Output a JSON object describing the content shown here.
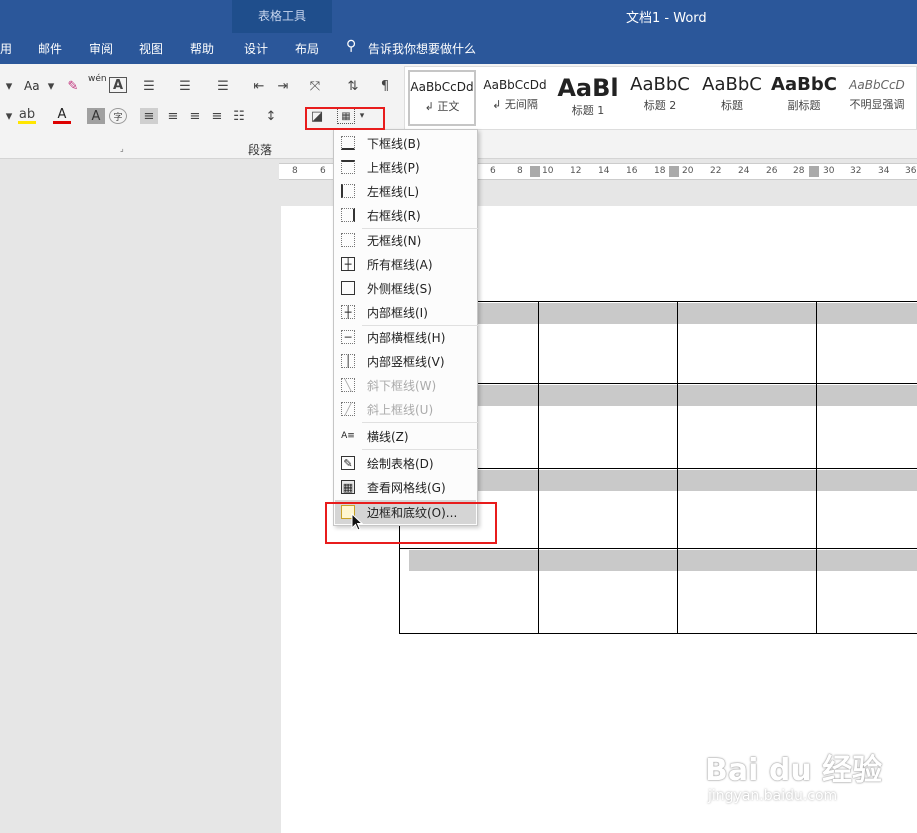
{
  "titlebar": {
    "context_group": "表格工具",
    "doc_title": "文档1  -  Word"
  },
  "tabs": [
    {
      "label": "用"
    },
    {
      "label": "邮件"
    },
    {
      "label": "审阅"
    },
    {
      "label": "视图"
    },
    {
      "label": "帮助"
    },
    {
      "label": "设计"
    },
    {
      "label": "布局"
    }
  ],
  "tellme": {
    "label": "告诉我你想要做什么"
  },
  "ribbon": {
    "paragraph_group": "段落",
    "aa": "Aa",
    "wen": "wén"
  },
  "styles": [
    {
      "preview": "AaBbCcDd",
      "name": "↲ 正文"
    },
    {
      "preview": "AaBbCcDd",
      "name": "↲ 无间隔"
    },
    {
      "preview": "AaBl",
      "name": "标题 1"
    },
    {
      "preview": "AaBbC",
      "name": "标题 2"
    },
    {
      "preview": "AaBbC",
      "name": "标题"
    },
    {
      "preview": "AaBbC",
      "name": "副标题"
    },
    {
      "preview": "AaBbCcD",
      "name": "不明显强调"
    }
  ],
  "ruler": {
    "ticks": [
      "8",
      "6",
      "6",
      "8",
      "10",
      "12",
      "14",
      "16",
      "18",
      "20",
      "22",
      "24",
      "26",
      "28",
      "30",
      "32",
      "34",
      "36"
    ]
  },
  "menu": {
    "items": [
      {
        "label": "下框线(B)"
      },
      {
        "label": "上框线(P)"
      },
      {
        "label": "左框线(L)"
      },
      {
        "label": "右框线(R)"
      },
      {
        "label": "无框线(N)"
      },
      {
        "label": "所有框线(A)"
      },
      {
        "label": "外侧框线(S)"
      },
      {
        "label": "内部框线(I)"
      },
      {
        "label": "内部横框线(H)"
      },
      {
        "label": "内部竖框线(V)"
      },
      {
        "label": "斜下框线(W)"
      },
      {
        "label": "斜上框线(U)"
      },
      {
        "label": "横线(Z)"
      },
      {
        "label": "绘制表格(D)"
      },
      {
        "label": "查看网格线(G)"
      },
      {
        "label": "边框和底纹(O)..."
      }
    ]
  },
  "watermark": {
    "brand": "Bai du 经验",
    "url": "jingyan.baidu.com"
  },
  "colors": {
    "accent": "#2b579a",
    "highlight_box": "#e81c1c",
    "shade": "#c9c9c9"
  }
}
